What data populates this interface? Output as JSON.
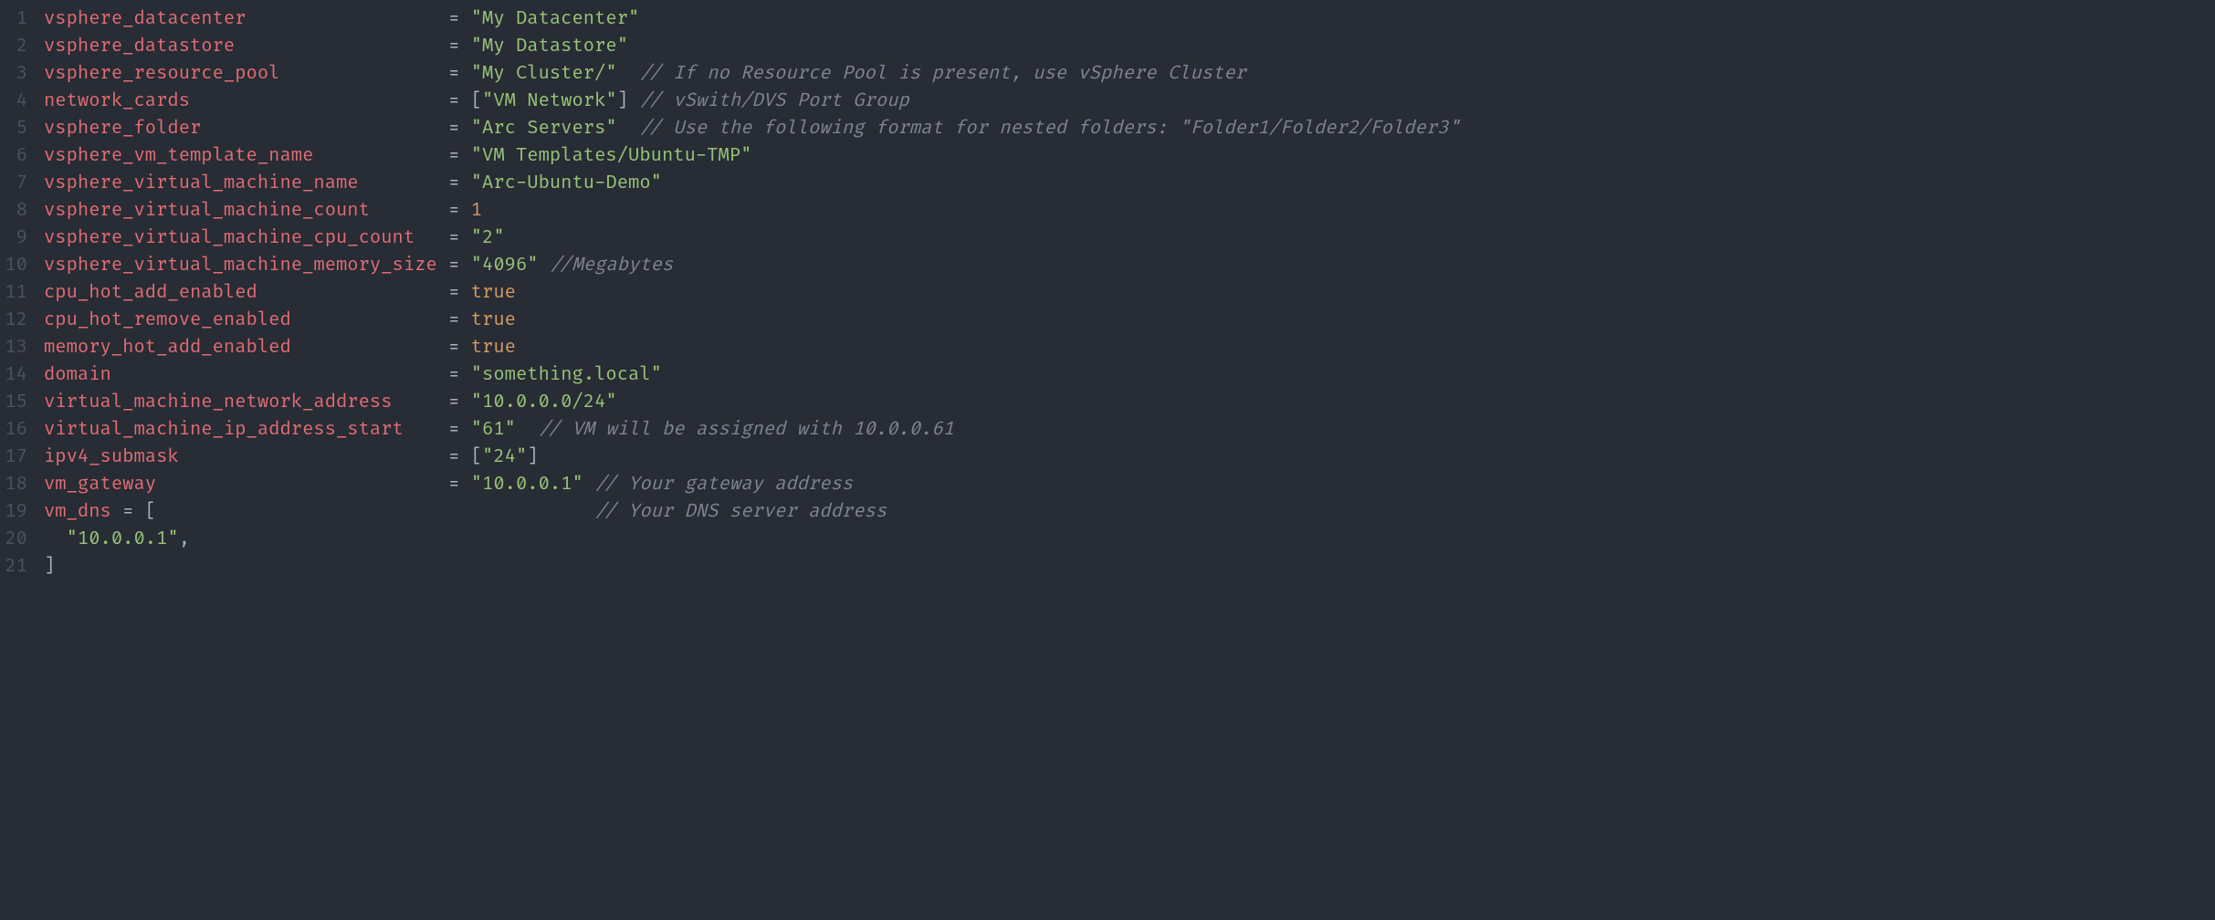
{
  "lines": [
    {
      "n": "1",
      "k": "vsphere_datacenter",
      "pad": "                  ",
      "op": "= ",
      "seg": [
        {
          "t": "str",
          "v": "\"My Datacenter\""
        }
      ]
    },
    {
      "n": "2",
      "k": "vsphere_datastore",
      "pad": "                   ",
      "op": "= ",
      "seg": [
        {
          "t": "str",
          "v": "\"My Datastore\""
        }
      ]
    },
    {
      "n": "3",
      "k": "vsphere_resource_pool",
      "pad": "               ",
      "op": "= ",
      "seg": [
        {
          "t": "str",
          "v": "\"My Cluster/\""
        },
        {
          "t": "txt",
          "v": "  "
        },
        {
          "t": "cmt",
          "v": "// If no Resource Pool is present, use vSphere Cluster"
        }
      ]
    },
    {
      "n": "4",
      "k": "network_cards",
      "pad": "                       ",
      "op": "= ",
      "seg": [
        {
          "t": "punct",
          "v": "["
        },
        {
          "t": "str",
          "v": "\"VM Network\""
        },
        {
          "t": "punct",
          "v": "]"
        },
        {
          "t": "txt",
          "v": " "
        },
        {
          "t": "cmt",
          "v": "// vSwith/DVS Port Group"
        }
      ]
    },
    {
      "n": "5",
      "k": "vsphere_folder",
      "pad": "                      ",
      "op": "= ",
      "seg": [
        {
          "t": "str",
          "v": "\"Arc Servers\""
        },
        {
          "t": "txt",
          "v": "  "
        },
        {
          "t": "cmt",
          "v": "// Use the following format for nested folders: \"Folder1/Folder2/Folder3\""
        }
      ]
    },
    {
      "n": "6",
      "k": "vsphere_vm_template_name",
      "pad": "            ",
      "op": "= ",
      "seg": [
        {
          "t": "str",
          "v": "\"VM Templates/Ubuntu-TMP\""
        }
      ]
    },
    {
      "n": "7",
      "k": "vsphere_virtual_machine_name",
      "pad": "        ",
      "op": "= ",
      "seg": [
        {
          "t": "str",
          "v": "\"Arc-Ubuntu-Demo\""
        }
      ]
    },
    {
      "n": "8",
      "k": "vsphere_virtual_machine_count",
      "pad": "       ",
      "op": "= ",
      "seg": [
        {
          "t": "num",
          "v": "1"
        }
      ]
    },
    {
      "n": "9",
      "k": "vsphere_virtual_machine_cpu_count",
      "pad": "   ",
      "op": "= ",
      "seg": [
        {
          "t": "str",
          "v": "\"2\""
        }
      ]
    },
    {
      "n": "10",
      "k": "vsphere_virtual_machine_memory_size",
      "pad": " ",
      "op": "= ",
      "seg": [
        {
          "t": "str",
          "v": "\"4096\""
        },
        {
          "t": "txt",
          "v": " "
        },
        {
          "t": "cmt",
          "v": "//Megabytes"
        }
      ]
    },
    {
      "n": "11",
      "k": "cpu_hot_add_enabled",
      "pad": "                 ",
      "op": "= ",
      "seg": [
        {
          "t": "bool",
          "v": "true"
        }
      ]
    },
    {
      "n": "12",
      "k": "cpu_hot_remove_enabled",
      "pad": "              ",
      "op": "= ",
      "seg": [
        {
          "t": "bool",
          "v": "true"
        }
      ]
    },
    {
      "n": "13",
      "k": "memory_hot_add_enabled",
      "pad": "              ",
      "op": "= ",
      "seg": [
        {
          "t": "bool",
          "v": "true"
        }
      ]
    },
    {
      "n": "14",
      "k": "domain",
      "pad": "                              ",
      "op": "= ",
      "seg": [
        {
          "t": "str",
          "v": "\"something.local\""
        }
      ]
    },
    {
      "n": "15",
      "k": "virtual_machine_network_address",
      "pad": "     ",
      "op": "= ",
      "seg": [
        {
          "t": "str",
          "v": "\"10.0.0.0/24\""
        }
      ]
    },
    {
      "n": "16",
      "k": "virtual_machine_ip_address_start",
      "pad": "    ",
      "op": "= ",
      "seg": [
        {
          "t": "str",
          "v": "\"61\""
        },
        {
          "t": "txt",
          "v": "  "
        },
        {
          "t": "cmt",
          "v": "// VM will be assigned with 10.0.0.61"
        }
      ]
    },
    {
      "n": "17",
      "k": "ipv4_submask",
      "pad": "                        ",
      "op": "= ",
      "seg": [
        {
          "t": "punct",
          "v": "["
        },
        {
          "t": "str",
          "v": "\"24\""
        },
        {
          "t": "punct",
          "v": "]"
        }
      ]
    },
    {
      "n": "18",
      "k": "vm_gateway",
      "pad": "                          ",
      "op": "= ",
      "seg": [
        {
          "t": "str",
          "v": "\"10.0.0.1\""
        },
        {
          "t": "txt",
          "v": " "
        },
        {
          "t": "cmt",
          "v": "// Your gateway address"
        }
      ]
    },
    {
      "n": "19",
      "k": "vm_dns",
      "pad": " ",
      "op": "= ",
      "seg": [
        {
          "t": "punct",
          "v": "["
        },
        {
          "t": "txt",
          "v": "                                       "
        },
        {
          "t": "cmt",
          "v": "// Your DNS server address"
        }
      ]
    },
    {
      "n": "20",
      "indent": "  ",
      "seg": [
        {
          "t": "str",
          "v": "\"10.0.0.1\""
        },
        {
          "t": "punct",
          "v": ","
        }
      ]
    },
    {
      "n": "21",
      "seg": [
        {
          "t": "punct",
          "v": "]"
        }
      ]
    }
  ]
}
